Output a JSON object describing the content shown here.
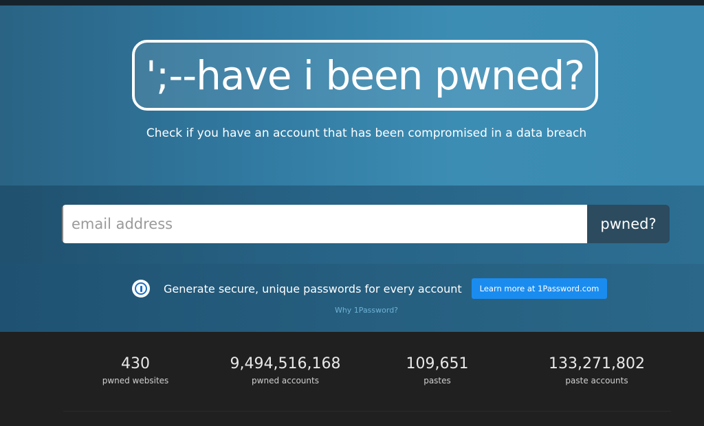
{
  "logo": {
    "text": "';--have i been pwned?"
  },
  "tagline": "Check if you have an account that has been compromised in a data breach",
  "search": {
    "placeholder": "email address",
    "value": "",
    "button_label": "pwned?"
  },
  "promo": {
    "icon": "1password-icon",
    "text": "Generate secure, unique passwords for every account",
    "button_label": "Learn more at 1Password.com",
    "why_link": "Why 1Password?"
  },
  "stats": [
    {
      "value": "430",
      "label": "pwned websites"
    },
    {
      "value": "9,494,516,168",
      "label": "pwned accounts"
    },
    {
      "value": "109,651",
      "label": "pastes"
    },
    {
      "value": "133,271,802",
      "label": "paste accounts"
    }
  ],
  "colors": {
    "hero_blue": "#3179a0",
    "button_dark": "#2c4b5e",
    "accent_blue": "#1a8cf0",
    "stats_bg": "#202020"
  }
}
